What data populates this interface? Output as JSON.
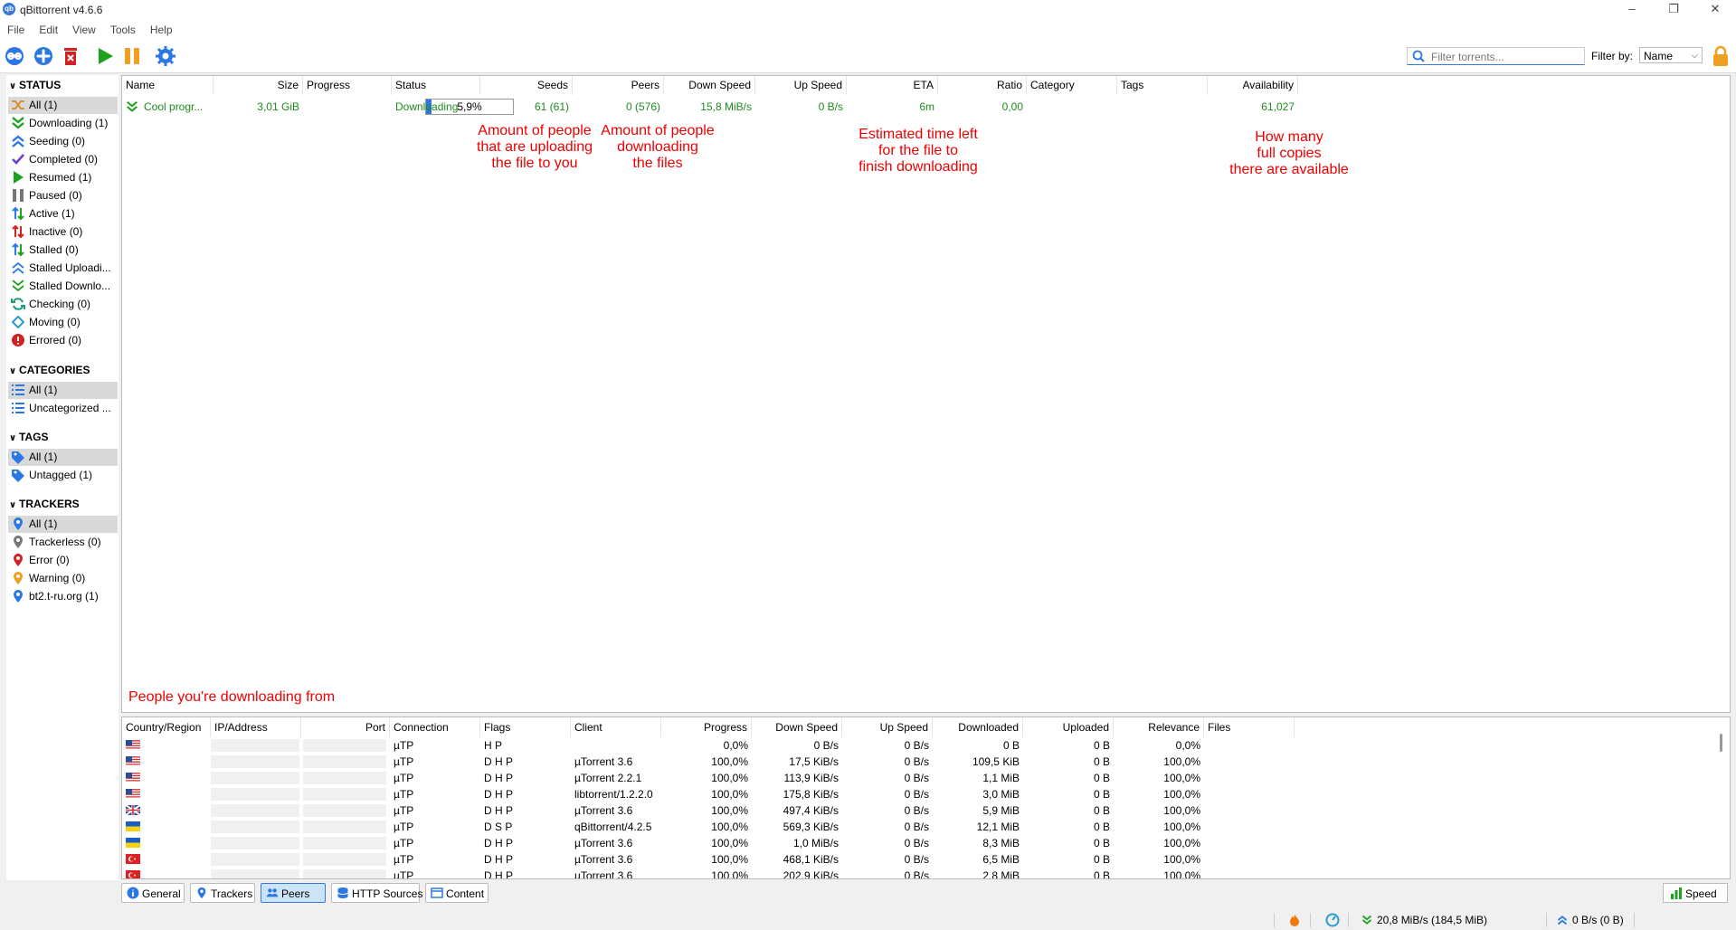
{
  "window": {
    "title": "qBittorrent v4.6.6",
    "minimize": "–",
    "maximize": "❐",
    "close": "✕"
  },
  "menu": [
    "File",
    "Edit",
    "View",
    "Tools",
    "Help"
  ],
  "toolbar": {
    "search_placeholder": "Filter torrents...",
    "filter_label": "Filter by:",
    "filter_value": "Name"
  },
  "sidebar": {
    "status": {
      "title": "STATUS",
      "items": [
        {
          "label": "All (1)",
          "icon": "all-icon",
          "selected": true
        },
        {
          "label": "Downloading (1)",
          "icon": "downloading-icon"
        },
        {
          "label": "Seeding (0)",
          "icon": "seeding-icon"
        },
        {
          "label": "Completed (0)",
          "icon": "completed-icon"
        },
        {
          "label": "Resumed (1)",
          "icon": "resumed-icon"
        },
        {
          "label": "Paused (0)",
          "icon": "paused-icon"
        },
        {
          "label": "Active (1)",
          "icon": "active-icon"
        },
        {
          "label": "Inactive (0)",
          "icon": "inactive-icon"
        },
        {
          "label": "Stalled (0)",
          "icon": "stalled-icon"
        },
        {
          "label": "Stalled Uploadi...",
          "icon": "stalled-uploading-icon"
        },
        {
          "label": "Stalled Downlo...",
          "icon": "stalled-downloading-icon"
        },
        {
          "label": "Checking (0)",
          "icon": "checking-icon"
        },
        {
          "label": "Moving (0)",
          "icon": "moving-icon"
        },
        {
          "label": "Errored (0)",
          "icon": "errored-icon"
        }
      ]
    },
    "categories": {
      "title": "CATEGORIES",
      "items": [
        {
          "label": "All (1)",
          "icon": "list-icon",
          "selected": true
        },
        {
          "label": "Uncategorized ...",
          "icon": "list-icon"
        }
      ]
    },
    "tags": {
      "title": "TAGS",
      "items": [
        {
          "label": "All (1)",
          "icon": "tag-icon",
          "selected": true
        },
        {
          "label": "Untagged (1)",
          "icon": "tag-icon"
        }
      ]
    },
    "trackers": {
      "title": "TRACKERS",
      "items": [
        {
          "label": "All (1)",
          "icon": "pin-icon",
          "selected": true
        },
        {
          "label": "Trackerless (0)",
          "icon": "pin-icon"
        },
        {
          "label": "Error (0)",
          "icon": "pin-icon"
        },
        {
          "label": "Warning (0)",
          "icon": "pin-icon"
        },
        {
          "label": "bt2.t-ru.org (1)",
          "icon": "pin-icon"
        }
      ]
    }
  },
  "torrent_list": {
    "columns": [
      "Name",
      "Size",
      "Progress",
      "Status",
      "Seeds",
      "Peers",
      "Down Speed",
      "Up Speed",
      "ETA",
      "Ratio",
      "Category",
      "Tags",
      "Availability"
    ],
    "row": {
      "name": "Cool progr...",
      "size": "3,01 GiB",
      "progress": "5,9%",
      "progress_fraction": 0.059,
      "status": "Downloading",
      "seeds": "61 (61)",
      "peers": "0 (576)",
      "down_speed": "15,8 MiB/s",
      "up_speed": "0 B/s",
      "eta": "6m",
      "ratio": "0,00",
      "category": "",
      "tags": "",
      "availability": "61,027"
    }
  },
  "annotations": {
    "seeds": [
      "Amount of people",
      "that are uploading",
      "the file to you"
    ],
    "peers": [
      "Amount of people",
      "downloading",
      "the files"
    ],
    "eta": [
      "Estimated time left",
      "for the file to",
      "finish downloading"
    ],
    "availability": [
      "How many",
      "full copies",
      "there are available"
    ],
    "peers_panel": "People you're downloading from"
  },
  "peers": {
    "columns": [
      "Country/Region",
      "IP/Address",
      "Port",
      "Connection",
      "Flags",
      "Client",
      "Progress",
      "Down Speed",
      "Up Speed",
      "Downloaded",
      "Uploaded",
      "Relevance",
      "Files"
    ],
    "rows": [
      {
        "flag": "us",
        "connection": "µTP",
        "flags": "H P",
        "client": "",
        "progress": "0,0%",
        "down": "0 B/s",
        "up": "0 B/s",
        "downloaded": "0 B",
        "uploaded": "0 B",
        "relevance": "0,0%"
      },
      {
        "flag": "us",
        "connection": "µTP",
        "flags": "D H P",
        "client": "µTorrent 3.6",
        "progress": "100,0%",
        "down": "17,5 KiB/s",
        "up": "0 B/s",
        "downloaded": "109,5 KiB",
        "uploaded": "0 B",
        "relevance": "100,0%"
      },
      {
        "flag": "us",
        "connection": "µTP",
        "flags": "D H P",
        "client": "µTorrent 2.2.1",
        "progress": "100,0%",
        "down": "113,9 KiB/s",
        "up": "0 B/s",
        "downloaded": "1,1 MiB",
        "uploaded": "0 B",
        "relevance": "100,0%"
      },
      {
        "flag": "us",
        "connection": "µTP",
        "flags": "D H P",
        "client": "libtorrent/1.2.2.0",
        "progress": "100,0%",
        "down": "175,8 KiB/s",
        "up": "0 B/s",
        "downloaded": "3,0 MiB",
        "uploaded": "0 B",
        "relevance": "100,0%"
      },
      {
        "flag": "gb",
        "connection": "µTP",
        "flags": "D H P",
        "client": "µTorrent 3.6",
        "progress": "100,0%",
        "down": "497,4 KiB/s",
        "up": "0 B/s",
        "downloaded": "5,9 MiB",
        "uploaded": "0 B",
        "relevance": "100,0%"
      },
      {
        "flag": "ua",
        "connection": "µTP",
        "flags": "D S P",
        "client": "qBittorrent/4.2.5",
        "progress": "100,0%",
        "down": "569,3 KiB/s",
        "up": "0 B/s",
        "downloaded": "12,1 MiB",
        "uploaded": "0 B",
        "relevance": "100,0%"
      },
      {
        "flag": "ua",
        "connection": "µTP",
        "flags": "D H P",
        "client": "µTorrent 3.6",
        "progress": "100,0%",
        "down": "1,0 MiB/s",
        "up": "0 B/s",
        "downloaded": "8,3 MiB",
        "uploaded": "0 B",
        "relevance": "100,0%"
      },
      {
        "flag": "tr",
        "connection": "µTP",
        "flags": "D H P",
        "client": "µTorrent 3.6",
        "progress": "100,0%",
        "down": "468,1 KiB/s",
        "up": "0 B/s",
        "downloaded": "6,5 MiB",
        "uploaded": "0 B",
        "relevance": "100,0%"
      },
      {
        "flag": "tr",
        "connection": "µTP",
        "flags": "D H P",
        "client": "µTorrent 3.6",
        "progress": "100,0%",
        "down": "202,9 KiB/s",
        "up": "0 B/s",
        "downloaded": "2,8 MiB",
        "uploaded": "0 B",
        "relevance": "100,0%"
      }
    ]
  },
  "tabs": [
    {
      "label": "General",
      "icon": "info-icon"
    },
    {
      "label": "Trackers",
      "icon": "pin-icon"
    },
    {
      "label": "Peers",
      "icon": "people-icon",
      "active": true
    },
    {
      "label": "HTTP Sources",
      "icon": "server-icon"
    },
    {
      "label": "Content",
      "icon": "folder-icon"
    }
  ],
  "speed_button": "Speed",
  "statusbar": {
    "download": "20,8 MiB/s (184,5 MiB)",
    "upload": "0 B/s (0 B)"
  },
  "colors": {
    "accent": "#3a78d8",
    "downloading_green": "#1e8a1e",
    "annotation_red": "#ee0000",
    "progress_fill": "#2b78e4"
  }
}
